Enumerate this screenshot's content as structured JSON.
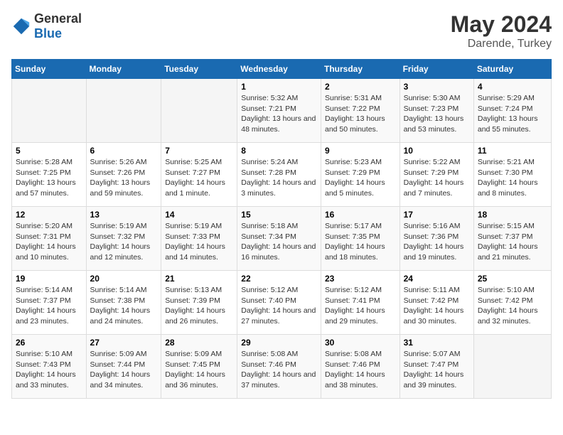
{
  "logo": {
    "text_general": "General",
    "text_blue": "Blue"
  },
  "header": {
    "month": "May 2024",
    "location": "Darende, Turkey"
  },
  "weekdays": [
    "Sunday",
    "Monday",
    "Tuesday",
    "Wednesday",
    "Thursday",
    "Friday",
    "Saturday"
  ],
  "weeks": [
    [
      {
        "day": "",
        "sunrise": "",
        "sunset": "",
        "daylight": ""
      },
      {
        "day": "",
        "sunrise": "",
        "sunset": "",
        "daylight": ""
      },
      {
        "day": "",
        "sunrise": "",
        "sunset": "",
        "daylight": ""
      },
      {
        "day": "1",
        "sunrise": "Sunrise: 5:32 AM",
        "sunset": "Sunset: 7:21 PM",
        "daylight": "Daylight: 13 hours and 48 minutes."
      },
      {
        "day": "2",
        "sunrise": "Sunrise: 5:31 AM",
        "sunset": "Sunset: 7:22 PM",
        "daylight": "Daylight: 13 hours and 50 minutes."
      },
      {
        "day": "3",
        "sunrise": "Sunrise: 5:30 AM",
        "sunset": "Sunset: 7:23 PM",
        "daylight": "Daylight: 13 hours and 53 minutes."
      },
      {
        "day": "4",
        "sunrise": "Sunrise: 5:29 AM",
        "sunset": "Sunset: 7:24 PM",
        "daylight": "Daylight: 13 hours and 55 minutes."
      }
    ],
    [
      {
        "day": "5",
        "sunrise": "Sunrise: 5:28 AM",
        "sunset": "Sunset: 7:25 PM",
        "daylight": "Daylight: 13 hours and 57 minutes."
      },
      {
        "day": "6",
        "sunrise": "Sunrise: 5:26 AM",
        "sunset": "Sunset: 7:26 PM",
        "daylight": "Daylight: 13 hours and 59 minutes."
      },
      {
        "day": "7",
        "sunrise": "Sunrise: 5:25 AM",
        "sunset": "Sunset: 7:27 PM",
        "daylight": "Daylight: 14 hours and 1 minute."
      },
      {
        "day": "8",
        "sunrise": "Sunrise: 5:24 AM",
        "sunset": "Sunset: 7:28 PM",
        "daylight": "Daylight: 14 hours and 3 minutes."
      },
      {
        "day": "9",
        "sunrise": "Sunrise: 5:23 AM",
        "sunset": "Sunset: 7:29 PM",
        "daylight": "Daylight: 14 hours and 5 minutes."
      },
      {
        "day": "10",
        "sunrise": "Sunrise: 5:22 AM",
        "sunset": "Sunset: 7:29 PM",
        "daylight": "Daylight: 14 hours and 7 minutes."
      },
      {
        "day": "11",
        "sunrise": "Sunrise: 5:21 AM",
        "sunset": "Sunset: 7:30 PM",
        "daylight": "Daylight: 14 hours and 8 minutes."
      }
    ],
    [
      {
        "day": "12",
        "sunrise": "Sunrise: 5:20 AM",
        "sunset": "Sunset: 7:31 PM",
        "daylight": "Daylight: 14 hours and 10 minutes."
      },
      {
        "day": "13",
        "sunrise": "Sunrise: 5:19 AM",
        "sunset": "Sunset: 7:32 PM",
        "daylight": "Daylight: 14 hours and 12 minutes."
      },
      {
        "day": "14",
        "sunrise": "Sunrise: 5:19 AM",
        "sunset": "Sunset: 7:33 PM",
        "daylight": "Daylight: 14 hours and 14 minutes."
      },
      {
        "day": "15",
        "sunrise": "Sunrise: 5:18 AM",
        "sunset": "Sunset: 7:34 PM",
        "daylight": "Daylight: 14 hours and 16 minutes."
      },
      {
        "day": "16",
        "sunrise": "Sunrise: 5:17 AM",
        "sunset": "Sunset: 7:35 PM",
        "daylight": "Daylight: 14 hours and 18 minutes."
      },
      {
        "day": "17",
        "sunrise": "Sunrise: 5:16 AM",
        "sunset": "Sunset: 7:36 PM",
        "daylight": "Daylight: 14 hours and 19 minutes."
      },
      {
        "day": "18",
        "sunrise": "Sunrise: 5:15 AM",
        "sunset": "Sunset: 7:37 PM",
        "daylight": "Daylight: 14 hours and 21 minutes."
      }
    ],
    [
      {
        "day": "19",
        "sunrise": "Sunrise: 5:14 AM",
        "sunset": "Sunset: 7:37 PM",
        "daylight": "Daylight: 14 hours and 23 minutes."
      },
      {
        "day": "20",
        "sunrise": "Sunrise: 5:14 AM",
        "sunset": "Sunset: 7:38 PM",
        "daylight": "Daylight: 14 hours and 24 minutes."
      },
      {
        "day": "21",
        "sunrise": "Sunrise: 5:13 AM",
        "sunset": "Sunset: 7:39 PM",
        "daylight": "Daylight: 14 hours and 26 minutes."
      },
      {
        "day": "22",
        "sunrise": "Sunrise: 5:12 AM",
        "sunset": "Sunset: 7:40 PM",
        "daylight": "Daylight: 14 hours and 27 minutes."
      },
      {
        "day": "23",
        "sunrise": "Sunrise: 5:12 AM",
        "sunset": "Sunset: 7:41 PM",
        "daylight": "Daylight: 14 hours and 29 minutes."
      },
      {
        "day": "24",
        "sunrise": "Sunrise: 5:11 AM",
        "sunset": "Sunset: 7:42 PM",
        "daylight": "Daylight: 14 hours and 30 minutes."
      },
      {
        "day": "25",
        "sunrise": "Sunrise: 5:10 AM",
        "sunset": "Sunset: 7:42 PM",
        "daylight": "Daylight: 14 hours and 32 minutes."
      }
    ],
    [
      {
        "day": "26",
        "sunrise": "Sunrise: 5:10 AM",
        "sunset": "Sunset: 7:43 PM",
        "daylight": "Daylight: 14 hours and 33 minutes."
      },
      {
        "day": "27",
        "sunrise": "Sunrise: 5:09 AM",
        "sunset": "Sunset: 7:44 PM",
        "daylight": "Daylight: 14 hours and 34 minutes."
      },
      {
        "day": "28",
        "sunrise": "Sunrise: 5:09 AM",
        "sunset": "Sunset: 7:45 PM",
        "daylight": "Daylight: 14 hours and 36 minutes."
      },
      {
        "day": "29",
        "sunrise": "Sunrise: 5:08 AM",
        "sunset": "Sunset: 7:46 PM",
        "daylight": "Daylight: 14 hours and 37 minutes."
      },
      {
        "day": "30",
        "sunrise": "Sunrise: 5:08 AM",
        "sunset": "Sunset: 7:46 PM",
        "daylight": "Daylight: 14 hours and 38 minutes."
      },
      {
        "day": "31",
        "sunrise": "Sunrise: 5:07 AM",
        "sunset": "Sunset: 7:47 PM",
        "daylight": "Daylight: 14 hours and 39 minutes."
      },
      {
        "day": "",
        "sunrise": "",
        "sunset": "",
        "daylight": ""
      }
    ]
  ]
}
